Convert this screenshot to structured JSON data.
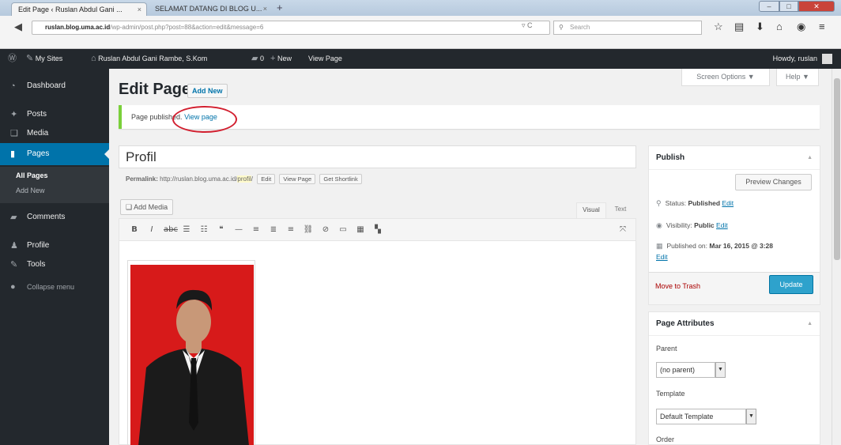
{
  "browser": {
    "tabs": [
      {
        "label": "Edit Page ‹ Ruslan Abdul Gani ...",
        "close": "×"
      },
      {
        "label": "SELAMAT DATANG DI BLOG U...",
        "close": "×"
      }
    ],
    "new_tab": "+",
    "url_host": "ruslan.blog.uma.ac.id",
    "url_path": "/wp-admin/post.php?post=88&action=edit&message=6",
    "search_placeholder": "Search"
  },
  "adminbar": {
    "my_sites": "My Sites",
    "site_name": "Ruslan Abdul Gani Rambe, S.Kom",
    "comments_count": "0",
    "new_label": "New",
    "view_page": "View Page",
    "howdy": "Howdy, ruslan"
  },
  "menu": {
    "dashboard": "Dashboard",
    "posts": "Posts",
    "media": "Media",
    "pages": "Pages",
    "all_pages": "All Pages",
    "add_new": "Add New",
    "comments": "Comments",
    "profile": "Profile",
    "tools": "Tools",
    "collapse": "Collapse menu"
  },
  "header": {
    "screen_options": "Screen Options ▼",
    "help": "Help ▼",
    "title": "Edit Page",
    "add_new": "Add New"
  },
  "notice": {
    "text": "Page published. ",
    "link": "View page"
  },
  "editor": {
    "post_title": "Profil",
    "permalink_label": "Permalink:",
    "permalink_base": "http://ruslan.blog.uma.ac.id/",
    "permalink_slug": "profil",
    "permalink_tail": "/",
    "edit_btn": "Edit",
    "view_page_btn": "View Page",
    "shortlink_btn": "Get Shortlink",
    "add_media": "Add Media",
    "visual_tab": "Visual",
    "text_tab": "Text"
  },
  "publish": {
    "heading": "Publish",
    "preview": "Preview Changes",
    "status_label": "Status:",
    "status_value": "Published",
    "visibility_label": "Visibility:",
    "visibility_value": "Public",
    "published_on": "Published on:",
    "published_date": "Mar 16, 2015 @ 3:28",
    "edit": "Edit",
    "trash": "Move to Trash",
    "update": "Update"
  },
  "attributes": {
    "heading": "Page Attributes",
    "parent_label": "Parent",
    "parent_value": "(no parent)",
    "template_label": "Template",
    "template_value": "Default Template",
    "order_label": "Order"
  },
  "colors": {
    "accent": "#0073aa",
    "adminbar": "#23282d",
    "notice_border": "#7ad03a",
    "update_button": "#2ea2cc",
    "annotation_circle": "#d21f2f"
  }
}
